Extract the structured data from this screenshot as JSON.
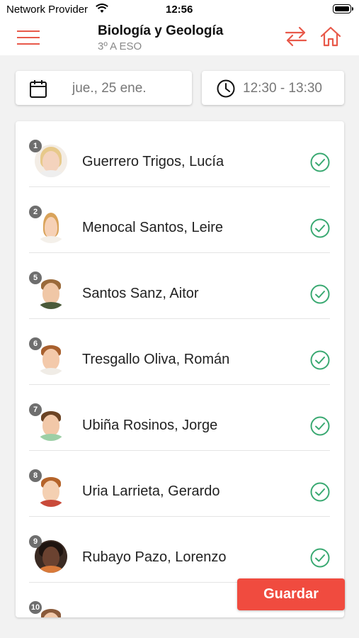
{
  "status_bar": {
    "carrier": "Network Provider",
    "time": "12:56"
  },
  "header": {
    "title": "Biología y Geología",
    "subtitle": "3º A ESO",
    "accent_color": "#e8594a",
    "icons": [
      "menu-icon",
      "swap-arrows-icon",
      "home-icon"
    ]
  },
  "session": {
    "date": "jue., 25 ene.",
    "time": "12:30 - 13:30"
  },
  "students": [
    {
      "number": "1",
      "name": "Guerrero Trigos, Lucía",
      "present": true
    },
    {
      "number": "2",
      "name": "Menocal Santos, Leire",
      "present": true
    },
    {
      "number": "5",
      "name": "Santos Sanz, Aitor",
      "present": true
    },
    {
      "number": "6",
      "name": "Tresgallo Oliva, Román",
      "present": true
    },
    {
      "number": "7",
      "name": "Ubiña Rosinos, Jorge",
      "present": true
    },
    {
      "number": "8",
      "name": "Uria Larrieta, Gerardo",
      "present": true
    },
    {
      "number": "9",
      "name": "Rubayo Pazo, Lorenzo",
      "present": true
    },
    {
      "number": "10",
      "name": "",
      "present": false
    }
  ],
  "save_label": "Guardar",
  "colors": {
    "check_green": "#3aa972",
    "save_red": "#f04b3f"
  }
}
